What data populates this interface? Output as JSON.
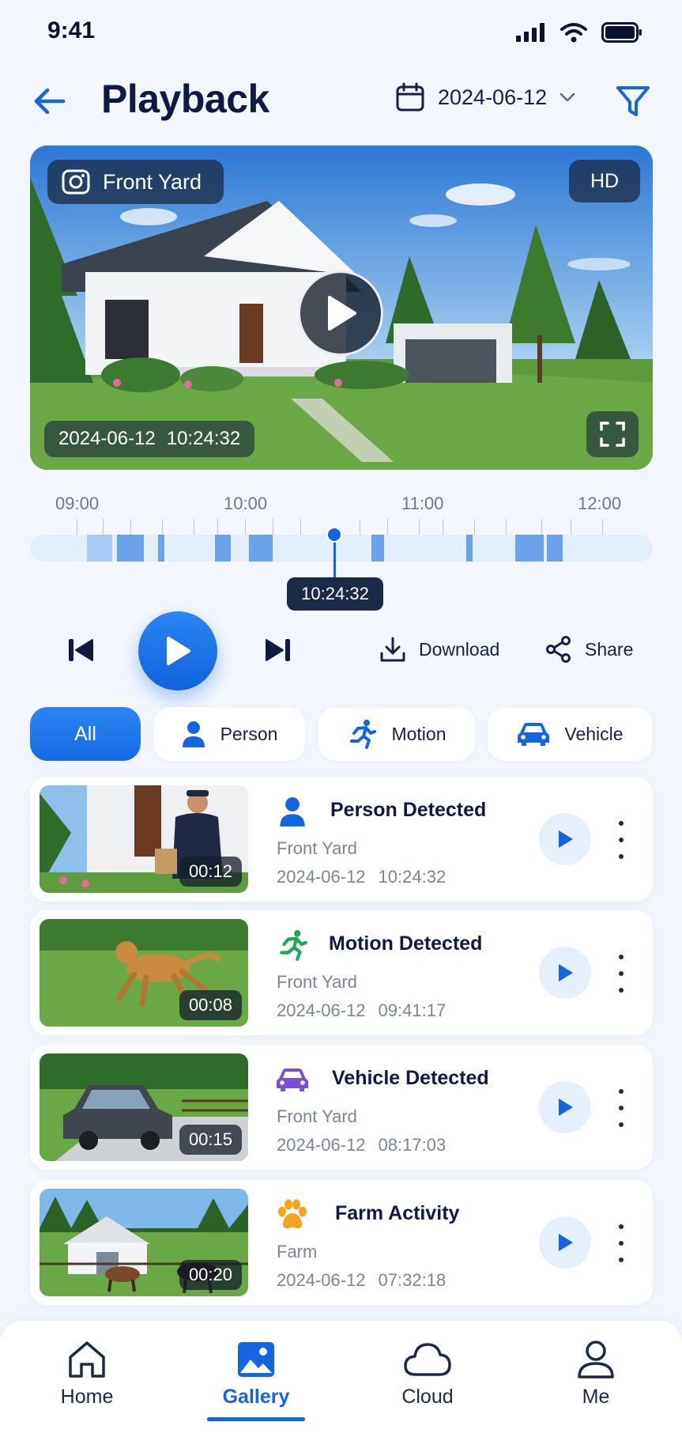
{
  "status_bar": {
    "time": "9:41"
  },
  "header": {
    "title": "Playback",
    "date": "2024-06-12"
  },
  "player": {
    "camera_name": "Front Yard",
    "quality": "HD",
    "timestamp_date": "2024-06-12",
    "timestamp_time": "10:24:32"
  },
  "timeline": {
    "labels": [
      "09:00",
      "10:00",
      "11:00",
      "12:00"
    ],
    "current_time": "10:24:32"
  },
  "controls": {
    "download_label": "Download",
    "share_label": "Share"
  },
  "filters": [
    {
      "label": "All",
      "icon": "grid-icon",
      "active": true
    },
    {
      "label": "Person",
      "icon": "person-icon",
      "active": false
    },
    {
      "label": "Motion",
      "icon": "running-icon",
      "active": false
    },
    {
      "label": "Vehicle",
      "icon": "car-icon",
      "active": false
    }
  ],
  "events": [
    {
      "title": "Person Detected",
      "location": "Front Yard",
      "date": "2024-06-12",
      "time": "10:24:32",
      "duration": "00:12",
      "icon": "person-icon",
      "icon_color": "#1466e0"
    },
    {
      "title": "Motion Detected",
      "location": "Front Yard",
      "date": "2024-06-12",
      "time": "09:41:17",
      "duration": "00:08",
      "icon": "running-icon",
      "icon_color": "#22a65a"
    },
    {
      "title": "Vehicle Detected",
      "location": "Front Yard",
      "date": "2024-06-12",
      "time": "08:17:03",
      "duration": "00:15",
      "icon": "car-icon",
      "icon_color": "#7b4fd8"
    },
    {
      "title": "Farm Activity",
      "location": "Farm",
      "date": "2024-06-12",
      "time": "07:32:18",
      "duration": "00:20",
      "icon": "paw-icon",
      "icon_color": "#f3a521"
    }
  ],
  "bottom_nav": [
    {
      "label": "Home",
      "icon": "home-icon",
      "active": false
    },
    {
      "label": "Gallery",
      "icon": "gallery-icon",
      "active": true
    },
    {
      "label": "Cloud",
      "icon": "cloud-icon",
      "active": false
    },
    {
      "label": "Me",
      "icon": "user-icon",
      "active": false
    }
  ],
  "colors": {
    "accent": "#1466e0",
    "background": "#f3f7fd",
    "timeline_segment": "#6aa3ea"
  }
}
